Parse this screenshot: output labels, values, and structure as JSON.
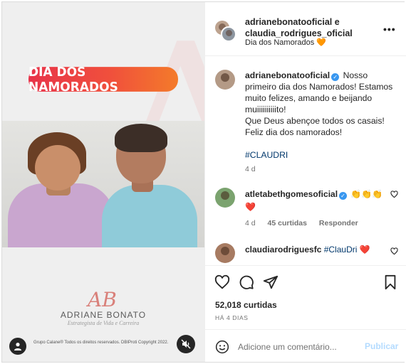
{
  "media": {
    "banner_text": "DIA DOS NAMORADOS",
    "logo_mark": "AB",
    "brand_name": "ADRIANE BONATO",
    "brand_subtitle": "Estrategista de Vida e Carreira",
    "copyright": "Grupo Calane® Todos os direitos reservados. DBIProti Copyright 2022."
  },
  "header": {
    "user1": "adrianebonatooficial",
    "joiner": " e",
    "user2": "claudia_rodrigues_oficial",
    "subtitle": "Dia dos Namorados",
    "subtitle_emoji": "🧡",
    "more_label": "•••"
  },
  "caption": {
    "username": "adrianebonatooficial",
    "verified_mark": "✓",
    "text": " Nosso primeiro dia dos Namorados! Estamos muito felizes, amando e beijando muiiiiiiiiiito!",
    "line2": "Que Deus abençoe todos os casais!",
    "line3": "Feliz dia dos namorados!",
    "hashtag": "#CLAUDRI",
    "age": "4 d"
  },
  "comments": [
    {
      "username": "atletabethgomesoficial",
      "verified_mark": "✓",
      "text": " 👏👏👏",
      "text2": "❤️",
      "age": "4 d",
      "likes": "45 curtidas",
      "reply": "Responder"
    },
    {
      "username": "claudiarodriguesfc",
      "text": " #ClauDri",
      "text2": " ❤️"
    }
  ],
  "actions": {
    "likes": "52,018 curtidas",
    "time": "HÁ 4 DIAS",
    "comment_placeholder": "Adicione um comentário...",
    "publish": "Publicar"
  },
  "colors": {
    "banner_start": "#e8344a",
    "banner_end": "#f47b2a",
    "hashtag": "#00376b",
    "verified": "#3897f0",
    "publish_disabled": "#b3dbff"
  }
}
